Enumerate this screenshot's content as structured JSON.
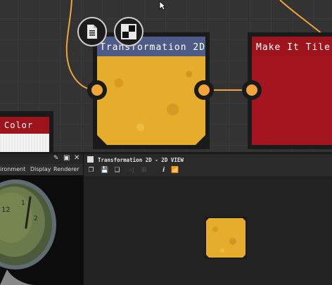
{
  "graph": {
    "nodes": {
      "transformation": {
        "title": "Transformation 2D",
        "header_color": "#4d5b86",
        "thumb_color": "#e6ad2c"
      },
      "make_tile": {
        "title": "Make It Tile",
        "header_color": "#9e141d",
        "thumb_color": "#a5151f"
      },
      "color": {
        "title": "Color",
        "header_color": "#9e141d"
      }
    },
    "buttons": {
      "doc_icon": "document-icon",
      "checker_icon": "checker-icon"
    },
    "wire_color": "#f0a43a"
  },
  "view3d": {
    "tabs": [
      "ironment",
      "Display",
      "Renderer"
    ],
    "panel_icons": [
      "pin-icon",
      "float-icon",
      "close-icon"
    ]
  },
  "view2d": {
    "title": "Transformation 2D - 2D VIEW"
  }
}
